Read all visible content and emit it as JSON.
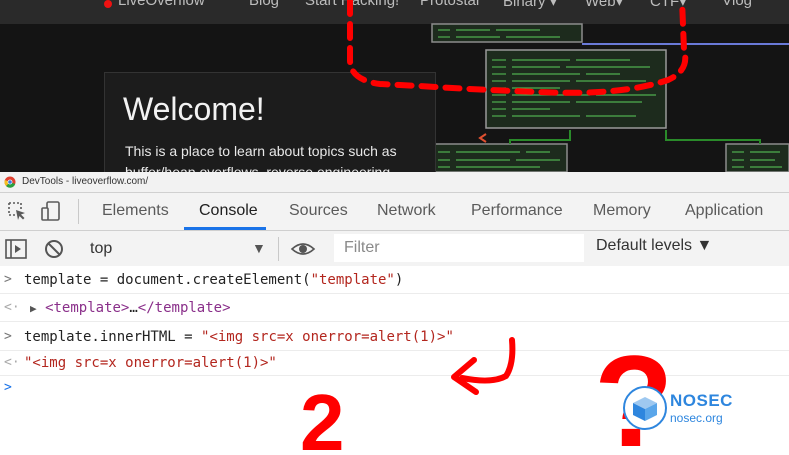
{
  "website": {
    "nav": [
      {
        "label": "LiveOverflow"
      },
      {
        "label": "Blog"
      },
      {
        "label": "Start Hacking!"
      },
      {
        "label": "Protostar"
      },
      {
        "label": "Binary ▾"
      },
      {
        "label": "Web▾"
      },
      {
        "label": "CTF▾"
      },
      {
        "label": "Vlog"
      }
    ],
    "welcome_title": "Welcome!",
    "welcome_text": "This is a place to learn about topics such as buffer/heap overflows, reverse engineering"
  },
  "devtools": {
    "title": "DevTools - liveoverflow.com/",
    "tabs": [
      "Elements",
      "Console",
      "Sources",
      "Network",
      "Performance",
      "Memory",
      "Application"
    ],
    "active_tab": "Console",
    "context": "top",
    "filter_placeholder": "Filter",
    "levels": "Default levels ▼"
  },
  "console": {
    "lines": [
      {
        "type": "input",
        "parts": [
          "template = document.createElement(",
          "\"template\"",
          ")"
        ]
      },
      {
        "type": "output",
        "parts": [
          "▶",
          "<template>",
          "…",
          "</template>"
        ]
      },
      {
        "type": "input",
        "parts": [
          "template.innerHTML = ",
          "\"<img src=x onerror=alert(1)>\""
        ]
      },
      {
        "type": "output",
        "parts": [
          "\"<img src=x onerror=alert(1)>\""
        ]
      }
    ]
  },
  "annotations": {
    "number": "2",
    "question": "?"
  },
  "watermark": {
    "name": "NOSEC",
    "sub": "nosec.org"
  },
  "colors": {
    "accent": "#1a73e8",
    "annotation": "#ff0000",
    "string": "#b3261e",
    "tag": "#8a2f8a",
    "watermark": "#2e86de"
  }
}
